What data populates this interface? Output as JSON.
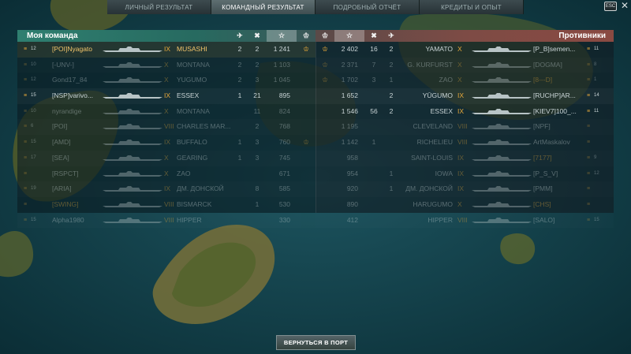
{
  "tabs": [
    {
      "label": "ЛИЧНЫЙ РЕЗУЛЬТАТ",
      "active": false
    },
    {
      "label": "КОМАНДНЫЙ РЕЗУЛЬТАТ",
      "active": true
    },
    {
      "label": "ПОДРОБНЫЙ ОТЧЁТ",
      "active": false
    },
    {
      "label": "КРЕДИТЫ И ОПЫТ",
      "active": false
    }
  ],
  "esc_label": "ESC",
  "close_glyph": "✕",
  "header_icons": {
    "planes": "✈",
    "kills": "✖",
    "star": "☆",
    "laurel": "♔"
  },
  "my_team": {
    "title": "Моя команда",
    "players": [
      {
        "rank": "12",
        "name": "[POI]Nyagato",
        "tier": "IX",
        "ship": "MUSASHI",
        "planes": "2",
        "kills": "2",
        "xp": "1 241",
        "medal": true,
        "player": true
      },
      {
        "rank": "10",
        "name": "[-UNV-]",
        "tier": "X",
        "ship": "MONTANA",
        "planes": "2",
        "kills": "2",
        "xp": "1 103",
        "dead": true
      },
      {
        "rank": "12",
        "name": "Gond17_84",
        "tier": "X",
        "ship": "YUGUMO",
        "planes": "2",
        "kills": "3",
        "xp": "1 045",
        "dead": true
      },
      {
        "rank": "15",
        "name": "[NSP]varivo...",
        "tier": "IX",
        "ship": "ESSEX",
        "planes": "1",
        "kills": "21",
        "xp": "895"
      },
      {
        "rank": "10",
        "name": "nyrandige",
        "tier": "X",
        "ship": "MONTANA",
        "planes": "",
        "kills": "11",
        "xp": "824",
        "dead": true
      },
      {
        "rank": "6",
        "name": "[POI]",
        "tier": "VIII",
        "ship": "CHARLES MAR...",
        "planes": "",
        "kills": "2",
        "xp": "768",
        "dead": true
      },
      {
        "rank": "15",
        "name": "[AMD]",
        "tier": "IX",
        "ship": "BUFFALO",
        "planes": "1",
        "kills": "3",
        "xp": "760",
        "medal": true,
        "dead": true
      },
      {
        "rank": "17",
        "name": "[SEA]",
        "tier": "X",
        "ship": "GEARING",
        "planes": "1",
        "kills": "3",
        "xp": "745",
        "dead": true
      },
      {
        "rank": "",
        "name": "[RSPCT]",
        "tier": "X",
        "ship": "ZAO",
        "planes": "",
        "kills": "",
        "xp": "671",
        "dead": true
      },
      {
        "rank": "19",
        "name": "[ARIA]",
        "tier": "IX",
        "ship": "ДМ. ДОНСКОЙ",
        "planes": "",
        "kills": "8",
        "xp": "585",
        "dead": true
      },
      {
        "rank": "",
        "name": "[SWING]",
        "tier": "VIII",
        "ship": "BISMARCK",
        "planes": "",
        "kills": "1",
        "xp": "530",
        "dead": true,
        "goldname": true
      },
      {
        "rank": "15",
        "name": "Alpha1980",
        "tier": "VIII",
        "ship": "HIPPER",
        "planes": "",
        "kills": "",
        "xp": "330",
        "dead": true
      }
    ]
  },
  "enemy_team": {
    "title": "Противники",
    "players": [
      {
        "xp": "2 402",
        "kills": "16",
        "planes": "2",
        "ship": "YAMATO",
        "tier": "X",
        "name": "[P_B]semen...",
        "rank": "11",
        "medal": true
      },
      {
        "xp": "2 371",
        "kills": "7",
        "planes": "2",
        "ship": "G. KURFURST",
        "tier": "X",
        "name": "[DOGMA]",
        "rank": "8",
        "medal": true,
        "dead": true
      },
      {
        "xp": "1 702",
        "kills": "3",
        "planes": "1",
        "ship": "ZAO",
        "tier": "X",
        "name": "[8---D]",
        "rank": "1",
        "medal": true,
        "dead": true,
        "goldname": true
      },
      {
        "xp": "1 652",
        "kills": "",
        "planes": "2",
        "ship": "YŪGUMO",
        "tier": "IX",
        "name": "[RUCHP]AR...",
        "rank": "14"
      },
      {
        "xp": "1 546",
        "kills": "56",
        "planes": "2",
        "ship": "ESSEX",
        "tier": "IX",
        "name": "[KIEV7]100_...",
        "rank": "11"
      },
      {
        "xp": "1 195",
        "kills": "",
        "planes": "",
        "ship": "CLEVELAND",
        "tier": "VIII",
        "name": "[NPF]",
        "rank": "",
        "dead": true
      },
      {
        "xp": "1 142",
        "kills": "1",
        "planes": "",
        "ship": "RICHELIEU",
        "tier": "VIII",
        "name": "ArtMaskalov",
        "rank": "",
        "dead": true
      },
      {
        "xp": "958",
        "kills": "",
        "planes": "",
        "ship": "SAINT-LOUIS",
        "tier": "IX",
        "name": "[7177]",
        "rank": "9",
        "dead": true,
        "goldname": true
      },
      {
        "xp": "954",
        "kills": "",
        "planes": "1",
        "ship": "IOWA",
        "tier": "IX",
        "name": "[P_S_V]",
        "rank": "12",
        "dead": true
      },
      {
        "xp": "920",
        "kills": "",
        "planes": "1",
        "ship": "ДМ. ДОНСКОЙ",
        "tier": "IX",
        "name": "[PMM]",
        "rank": "",
        "dead": true
      },
      {
        "xp": "890",
        "kills": "",
        "planes": "",
        "ship": "HARUGUMO",
        "tier": "X",
        "name": "[CHS]",
        "rank": "",
        "dead": true,
        "goldname": true
      },
      {
        "xp": "412",
        "kills": "",
        "planes": "",
        "ship": "HIPPER",
        "tier": "VIII",
        "name": "[SALO]",
        "rank": "15",
        "dead": true
      }
    ]
  },
  "port_button": "ВЕРНУТЬСЯ В ПОРТ"
}
